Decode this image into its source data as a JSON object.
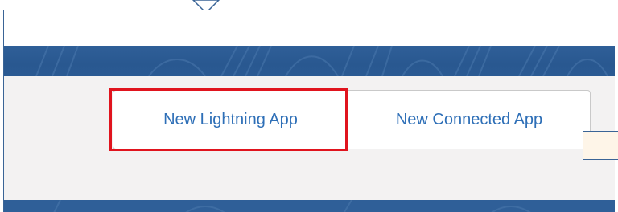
{
  "app_launcher": {
    "buttons": {
      "new_lightning_app": "New Lightning App",
      "new_connected_app": "New Connected App"
    }
  },
  "colors": {
    "banner_blue": "#2f5f98",
    "link_blue": "#2e6fb7",
    "highlight_red": "#e0141e",
    "content_gray": "#f3f2f2",
    "tooltip_fill": "#fef5e8"
  },
  "icons": {
    "callout_pointer": "callout-arrow-icon"
  }
}
